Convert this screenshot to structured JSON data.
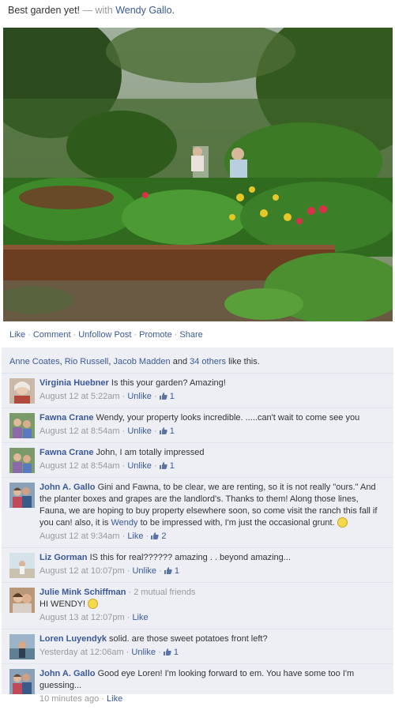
{
  "post": {
    "text": "Best garden yet!",
    "with_label": " — with ",
    "tagged": "Wendy Gallo",
    "end": "."
  },
  "actions": [
    {
      "label": "Like"
    },
    {
      "label": "Comment"
    },
    {
      "label": "Unfollow Post"
    },
    {
      "label": "Promote"
    },
    {
      "label": "Share"
    }
  ],
  "likes": {
    "names": [
      "Anne Coates",
      "Rio Russell",
      "Jacob Madden"
    ],
    "and_label": " and ",
    "others": "34 others",
    "suffix": " like this.",
    "sep": ", "
  },
  "comments": [
    {
      "name": "Virginia Huebner",
      "text": "Is this your garden? Amazing!",
      "time": "August 12 at 5:22am",
      "action": "Unlike",
      "likes": "1"
    },
    {
      "name": "Fawna Crane",
      "text": "Wendy, your property looks incredible. .....can't wait to come see you",
      "time": "August 12 at 8:54am",
      "action": "Unlike",
      "likes": "1"
    },
    {
      "name": "Fawna Crane",
      "text": "John, I am totally impressed",
      "time": "August 12 at 8:54am",
      "action": "Unlike",
      "likes": "1"
    },
    {
      "name": "John A. Gallo",
      "text_a": "Gini and Fawna, to be clear, we are renting, so it is not really \"ours.\" And the planter boxes and grapes are the landlord's. Thanks to them! Along those lines, Fauna, we are hoping to buy property elsewhere soon, so come visit the ranch this fall if you can! also, it is ",
      "text_link": "Wendy",
      "text_b": " to be impressed with, I'm just the occasional grunt.",
      "time": "August 12 at 9:34am",
      "action": "Like",
      "likes": "2"
    },
    {
      "name": "Liz Gorman",
      "text": "IS this for real?????? amazing . . beyond amazing...",
      "time": "August 12 at 10:07pm",
      "action": "Unlike",
      "likes": "1"
    },
    {
      "name": "Julie Mink Schiffman",
      "mutual": " · 2 mutual friends",
      "text": "HI WENDY!",
      "time": "August 13 at 12:07pm",
      "action": "Like"
    },
    {
      "name": "Loren Luyendyk",
      "text": "solid. are those sweet potatoes front left?",
      "time": "Yesterday at 12:06am",
      "action": "Unlike",
      "likes": "1"
    },
    {
      "name": "John A. Gallo",
      "text": "Good eye Loren! I'm looking forward to em. You have some too I'm guessing...",
      "time": "10 minutes ago",
      "action": "Like"
    }
  ],
  "colors": {
    "link": "#3b5998",
    "meta": "#999999",
    "ufi_bg": "#edeff4"
  },
  "icons": [
    "thumbs-up-icon",
    "smiley-icon"
  ],
  "separator": "·"
}
